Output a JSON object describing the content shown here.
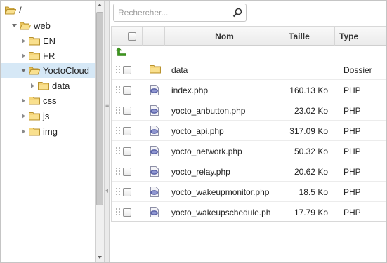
{
  "tree": {
    "nodes": [
      {
        "label": "/",
        "expanded": true,
        "has_children": true
      },
      {
        "label": "web",
        "expanded": true,
        "has_children": true
      },
      {
        "label": "EN",
        "expanded": false,
        "has_children": true
      },
      {
        "label": "FR",
        "expanded": false,
        "has_children": true
      },
      {
        "label": "YoctoCloud",
        "expanded": true,
        "has_children": true,
        "selected": true
      },
      {
        "label": "data",
        "expanded": false,
        "has_children": true
      },
      {
        "label": "css",
        "expanded": false,
        "has_children": true
      },
      {
        "label": "js",
        "expanded": false,
        "has_children": true
      },
      {
        "label": "img",
        "expanded": false,
        "has_children": true
      }
    ]
  },
  "search": {
    "placeholder": "Rechercher...",
    "value": ""
  },
  "grid": {
    "columns": {
      "name": "Nom",
      "size": "Taille",
      "type": "Type"
    },
    "rows": [
      {
        "name": "data",
        "size": "",
        "type": "Dossier",
        "icon": "folder-icon"
      },
      {
        "name": "index.php",
        "size": "160.13 Ko",
        "type": "PHP",
        "icon": "php-file-icon"
      },
      {
        "name": "yocto_anbutton.php",
        "size": "23.02 Ko",
        "type": "PHP",
        "icon": "php-file-icon"
      },
      {
        "name": "yocto_api.php",
        "size": "317.09 Ko",
        "type": "PHP",
        "icon": "php-file-icon"
      },
      {
        "name": "yocto_network.php",
        "size": "50.32 Ko",
        "type": "PHP",
        "icon": "php-file-icon"
      },
      {
        "name": "yocto_relay.php",
        "size": "20.62 Ko",
        "type": "PHP",
        "icon": "php-file-icon"
      },
      {
        "name": "yocto_wakeupmonitor.php",
        "size": "18.5 Ko",
        "type": "PHP",
        "icon": "php-file-icon"
      },
      {
        "name": "yocto_wakeupschedule.ph",
        "size": "17.79 Ko",
        "type": "PHP",
        "icon": "php-file-icon"
      }
    ]
  },
  "colors": {
    "selection": "#d6e8f6",
    "folder": "#f5d57a",
    "up_arrow": "#3c9a1c"
  }
}
